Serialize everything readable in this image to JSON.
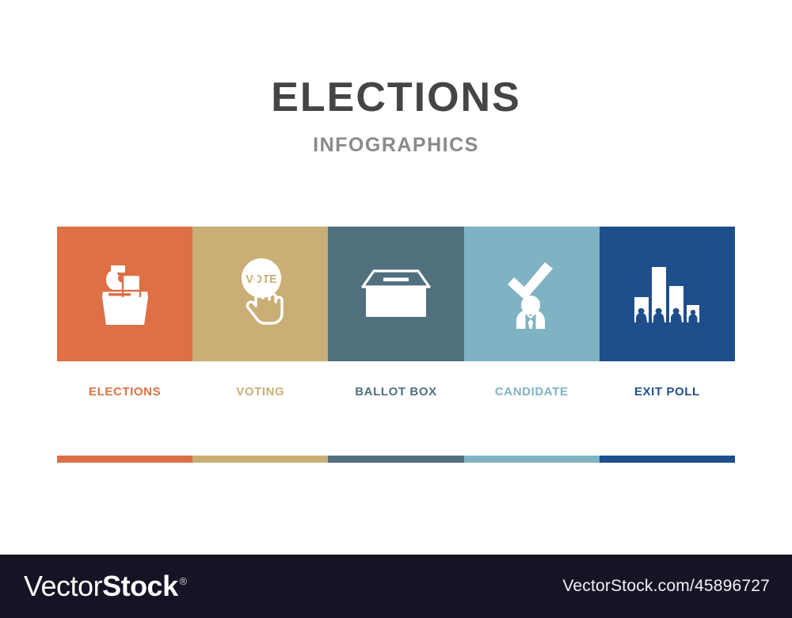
{
  "header": {
    "title": "ELECTIONS",
    "subtitle": "INFOGRAPHICS",
    "title_color": "#454545",
    "subtitle_color": "#8a8a8a"
  },
  "steps": [
    {
      "label": "ELECTIONS",
      "color": "#DD7044",
      "icon": "ballot-hand-icon"
    },
    {
      "label": "VOTING",
      "color": "#C9AF76",
      "icon": "vote-cursor-icon"
    },
    {
      "label": "BALLOT BOX",
      "color": "#50707E",
      "icon": "ballot-box-icon"
    },
    {
      "label": "CANDIDATE",
      "color": "#7FB3C4",
      "icon": "candidate-check-icon"
    },
    {
      "label": "EXIT POLL",
      "color": "#1F4E8C",
      "icon": "bar-chart-people-icon"
    }
  ],
  "icon_text": {
    "vote_button": "VOTE"
  },
  "footer": {
    "logo_first": "Vector",
    "logo_second": "Stock",
    "logo_trademark": "®",
    "url": "VectorStock.com/45896727",
    "background": "#141424"
  },
  "page": {
    "background": "#ffffff"
  }
}
